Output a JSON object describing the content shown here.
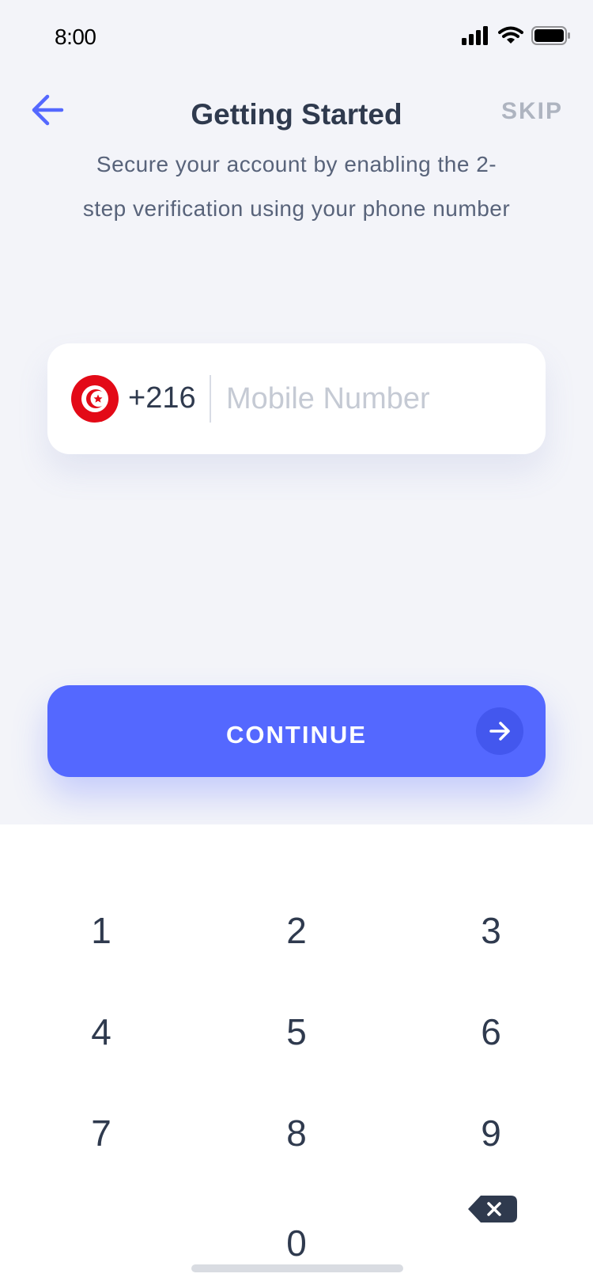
{
  "status_bar": {
    "time": "8:00",
    "icons": [
      "cellular-signal-icon",
      "wifi-icon",
      "battery-icon"
    ]
  },
  "header": {
    "back_icon": "arrow-left-icon",
    "title": "Getting Started",
    "skip_label": "SKIP",
    "subtitle_line1": "Secure your account by enabling the 2-",
    "subtitle_line2": "step verification using your phone number"
  },
  "phone_input": {
    "country_flag": "tunisia-flag-icon",
    "country_code": "+216",
    "value": "",
    "placeholder": "Mobile Number"
  },
  "continue_button": {
    "label": "CONTINUE",
    "icon": "arrow-right-icon"
  },
  "keypad": {
    "keys": [
      "1",
      "2",
      "3",
      "4",
      "5",
      "6",
      "7",
      "8",
      "9",
      "0"
    ],
    "backspace_icon": "backspace-icon"
  },
  "colors": {
    "accent": "#5468FF",
    "accent_dark": "#4357EE",
    "background": "#F3F4F9",
    "text_primary": "#2F3A4E",
    "text_secondary": "#58637A",
    "muted": "#AEB4C0",
    "flag_red": "#E30A17"
  }
}
